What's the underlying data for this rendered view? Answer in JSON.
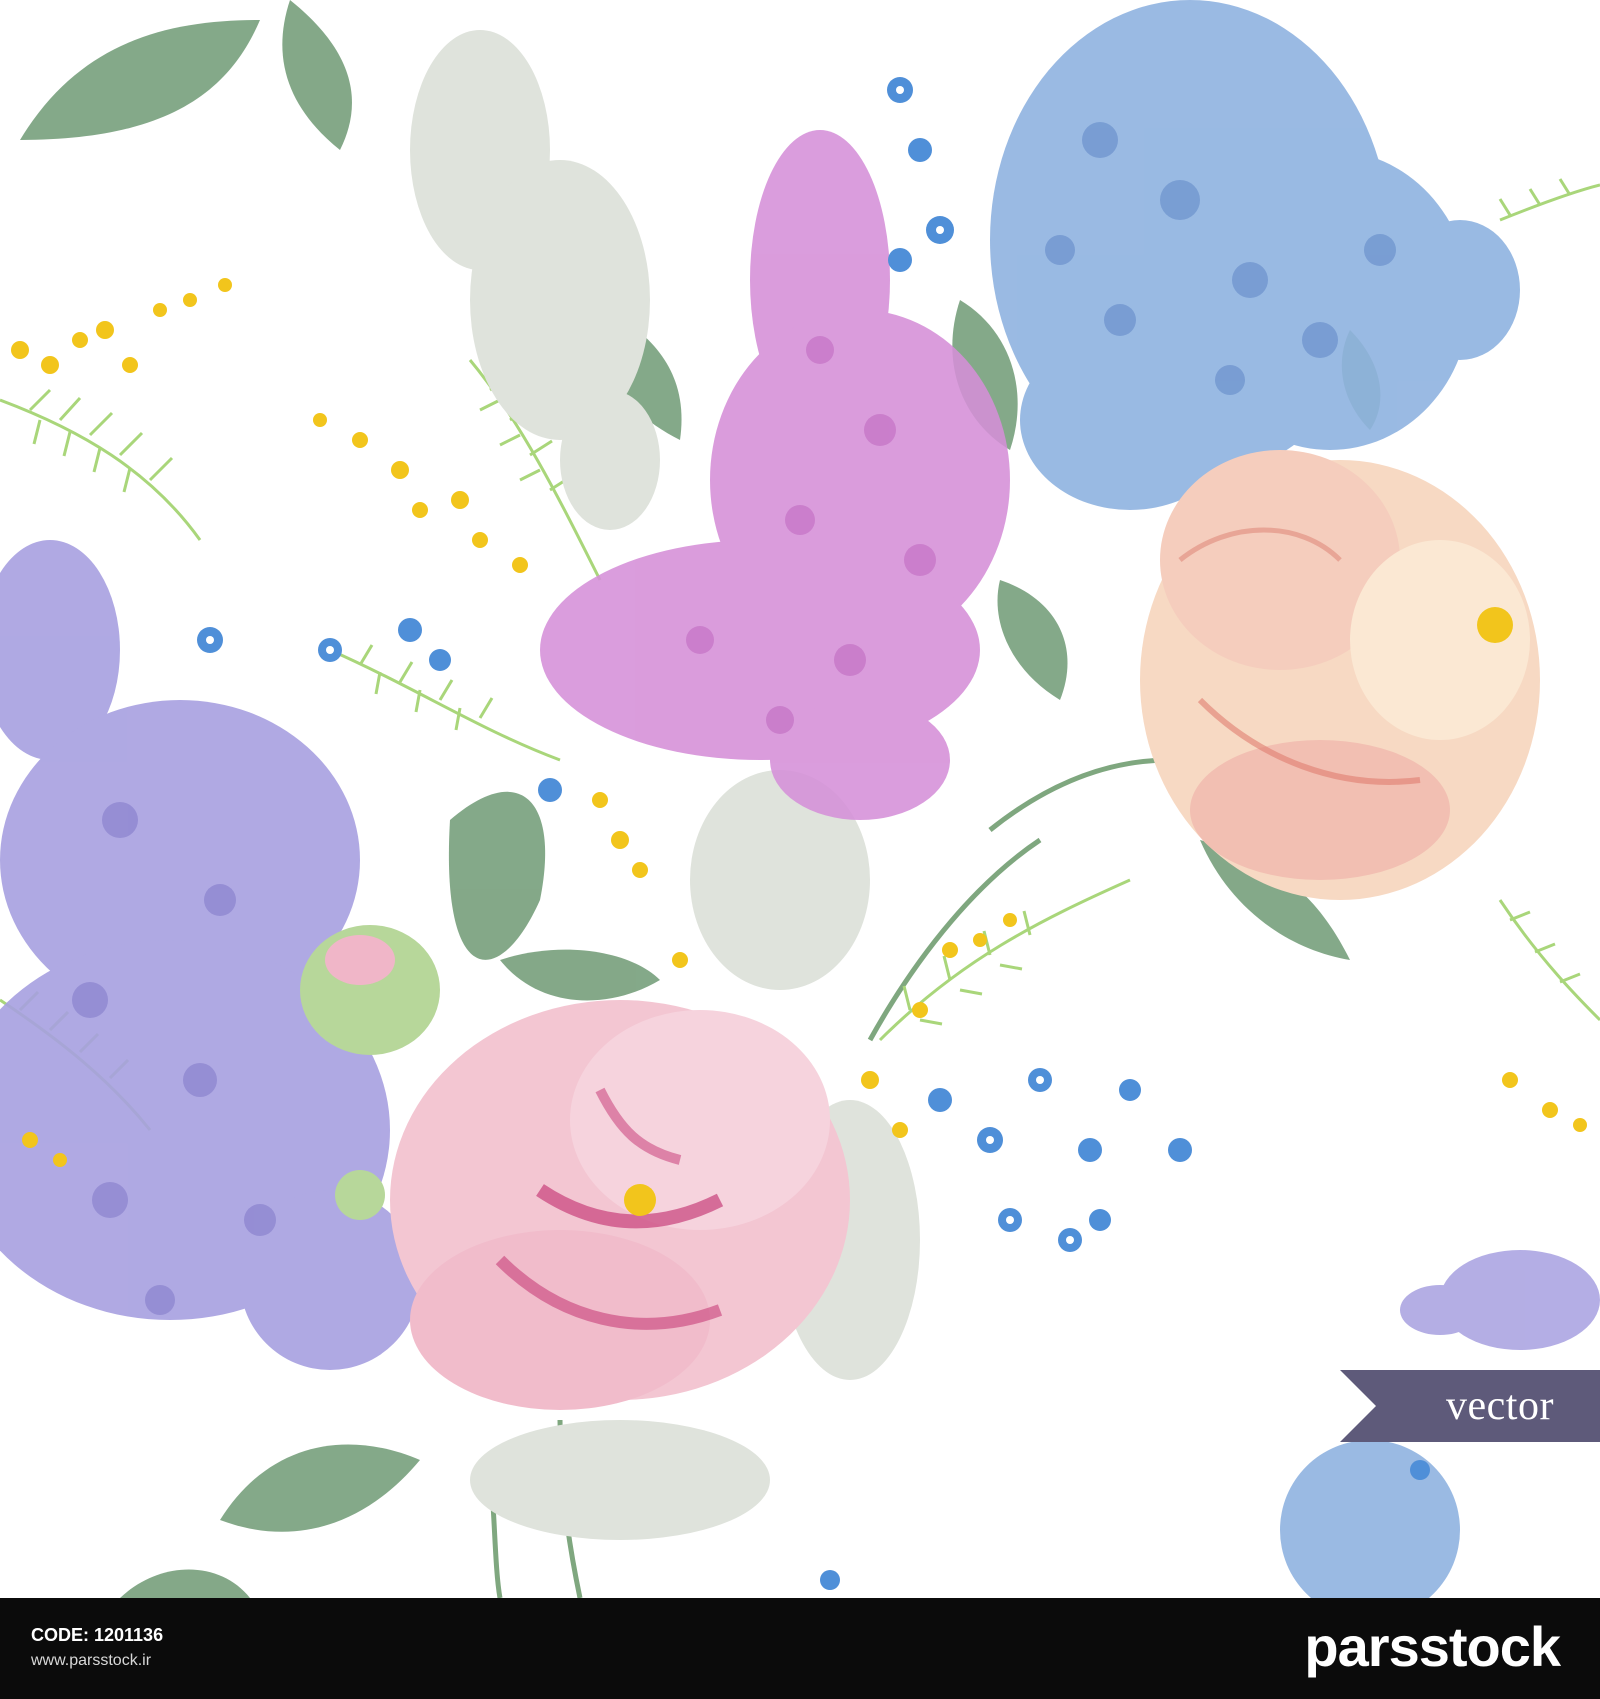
{
  "badge": {
    "label": "vector",
    "color": "#5e5a7a"
  },
  "footer": {
    "code_label": "CODE: 1201136",
    "website": "www.parsstock.ir",
    "brand": "parsstock",
    "background": "#0b0b0b"
  },
  "palette": {
    "lilac_blue": "#8fb3e0",
    "lilac_pink": "#d58fd8",
    "lilac_purple": "#a7a0e0",
    "lilac_white": "#dfe3dc",
    "peony_pink": "#f3c6d2",
    "peony_magenta": "#c8407a",
    "rose_peach": "#f7d9c3",
    "leaf_green": "#6f9a74",
    "fern_green": "#a9d67a",
    "mimosa_yellow": "#f2c51c",
    "forget_me_not": "#4f8fd8"
  }
}
